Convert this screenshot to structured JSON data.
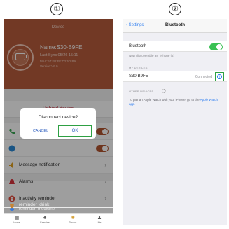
{
  "step_labels": [
    "①",
    "②"
  ],
  "left_screen": {
    "header_title": "Device",
    "device_name": "Name:S30-B9FE",
    "last_sync": "Last Sync:05/26 15:11",
    "mac": "MAC:67:FB:FE:D2:5D:B9",
    "version": "Version:V6.0",
    "unbind_label": "Unbind device",
    "dialog": {
      "title": "Disconnect device?",
      "cancel": "CANCEL",
      "ok": "OK"
    },
    "menu": [
      {
        "label": "Message notification",
        "icon": "speaker-icon"
      },
      {
        "label": "Alarms",
        "icon": "bell-icon"
      },
      {
        "label": "Inactivity reminder",
        "icon": "person-icon"
      },
      {
        "label": "reminder_drink",
        "icon": "cup-icon"
      },
      {
        "label": "reminder_medicine",
        "icon": "pill-icon"
      }
    ],
    "nav": [
      "Home",
      "Exercise",
      "Device",
      "Me"
    ],
    "colors": {
      "header": "#b85c3c",
      "accent": "#b2552f",
      "danger": "#c2283a",
      "highlight": "#2ea043"
    }
  },
  "right_screen": {
    "back_label": "Settings",
    "title": "Bluetooth",
    "bluetooth_label": "Bluetooth",
    "discoverable_text": "Now discoverable as \"iPhone (4)\".",
    "my_devices_header": "MY DEVICES",
    "device_name": "S30-B9FE",
    "device_status": "Connected",
    "other_devices_header": "OTHER DEVICES",
    "pair_text_prefix": "To pair an Apple Watch with your iPhone, go to the ",
    "pair_link": "Apple Watch app.",
    "colors": {
      "switch_on": "#39c153",
      "link": "#2b7cf0"
    }
  }
}
